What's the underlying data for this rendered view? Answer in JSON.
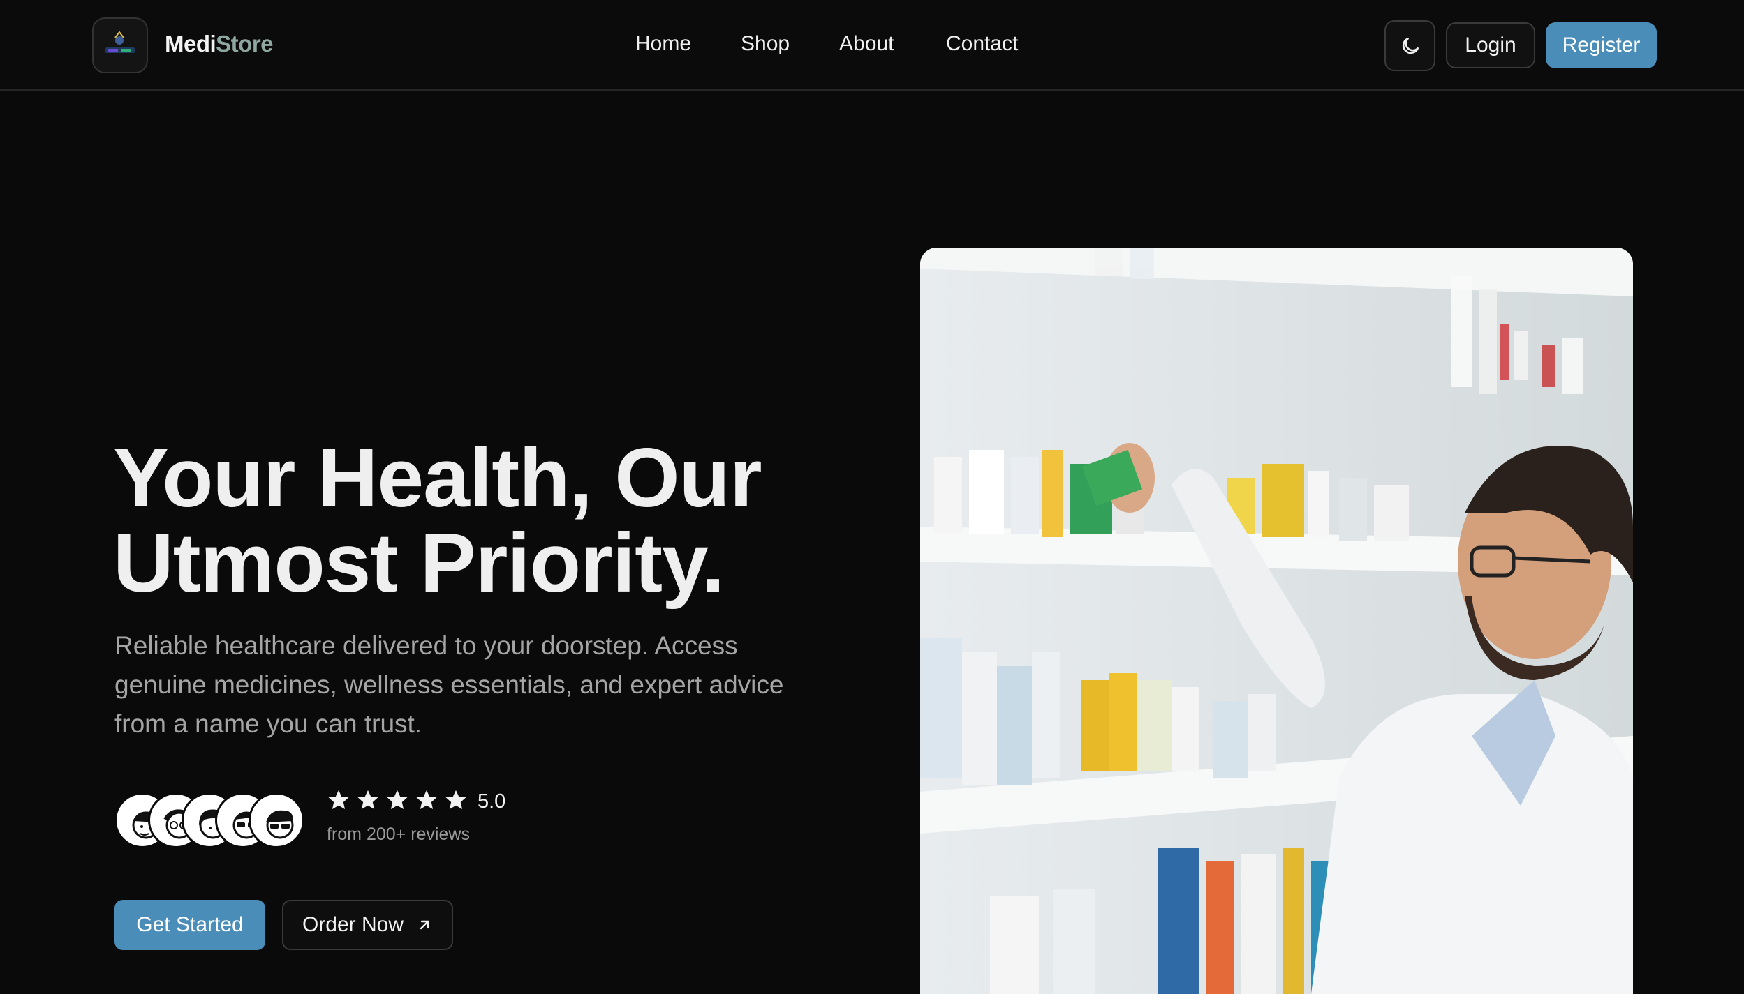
{
  "brand": {
    "part1": "Medi",
    "part2": "Store",
    "logo_icon": "pharmacy-logo-icon"
  },
  "nav": {
    "items": [
      {
        "label": "Home"
      },
      {
        "label": "Shop"
      },
      {
        "label": "About"
      },
      {
        "label": "Contact"
      }
    ],
    "theme_toggle_icon": "moon-icon",
    "login_label": "Login",
    "register_label": "Register"
  },
  "hero": {
    "title_line1": "Your Health, Our",
    "title_line2": "Utmost Priority.",
    "description": "Reliable healthcare delivered to your doorstep. Access genuine medicines, wellness essentials, and expert advice from a name you can trust.",
    "rating_value": "5.0",
    "stars": 5,
    "reviews_text": "from 200+ reviews",
    "cta_primary": "Get Started",
    "cta_secondary": "Order Now",
    "cta_secondary_icon": "arrow-up-right-icon",
    "image": "pharmacist-at-shelves-photo"
  },
  "colors": {
    "accent": "#4a8db8",
    "background": "#0a0a0a",
    "brand_secondary": "#8fa7a1"
  }
}
